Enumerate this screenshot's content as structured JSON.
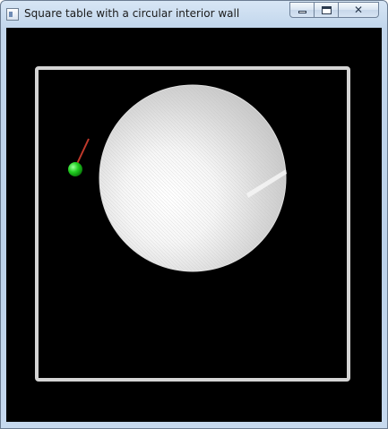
{
  "window": {
    "title": "Square table with a circular interior wall",
    "controls": {
      "minimize_icon": "minimize-icon",
      "maximize_icon": "restore-icon",
      "close_icon": "close-icon",
      "close_glyph": "✕"
    }
  },
  "scene": {
    "background_color": "#000000",
    "table_border_color": "#d4d4d4",
    "interior_wall_color": "#e6e6e6",
    "ball_color": "#1fcf1f",
    "velocity_vector_color": "#c0392b"
  }
}
